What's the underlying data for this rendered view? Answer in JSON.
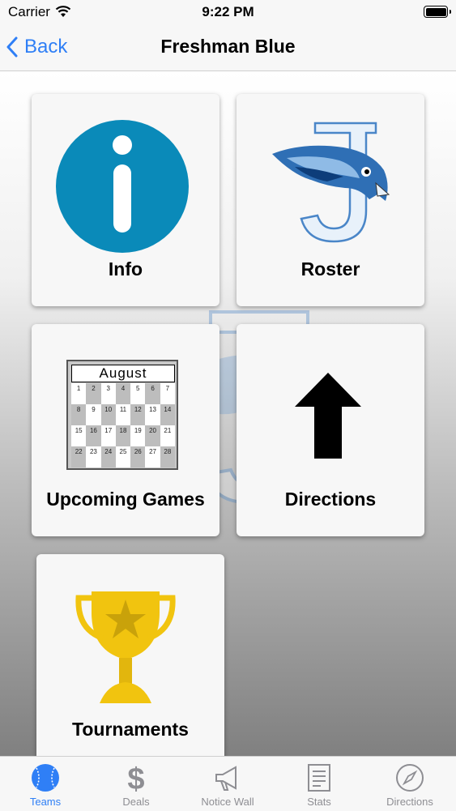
{
  "status_bar": {
    "carrier": "Carrier",
    "time": "9:22 PM"
  },
  "nav": {
    "back_label": "Back",
    "title": "Freshman Blue"
  },
  "tiles": {
    "info": {
      "label": "Info",
      "icon": "info-icon"
    },
    "roster": {
      "label": "Roster",
      "icon": "bluejay-logo"
    },
    "upcoming_games": {
      "label": "Upcoming Games",
      "icon": "calendar-icon",
      "month": "August",
      "days": [
        "1",
        "2",
        "3",
        "4",
        "5",
        "6",
        "7",
        "8",
        "9",
        "10",
        "11",
        "12",
        "13",
        "14",
        "15",
        "16",
        "17",
        "18",
        "19",
        "20",
        "21",
        "22",
        "23",
        "24",
        "25",
        "26",
        "27",
        "28"
      ]
    },
    "directions": {
      "label": "Directions",
      "icon": "up-arrow-icon"
    },
    "tournaments": {
      "label": "Tournaments",
      "icon": "trophy-icon"
    }
  },
  "tab_bar": {
    "items": [
      {
        "label": "Teams",
        "icon": "baseball-icon",
        "active": true
      },
      {
        "label": "Deals",
        "icon": "dollar-icon",
        "active": false
      },
      {
        "label": "Notice Wall",
        "icon": "megaphone-icon",
        "active": false
      },
      {
        "label": "Stats",
        "icon": "document-icon",
        "active": false
      },
      {
        "label": "Directions",
        "icon": "compass-icon",
        "active": false
      }
    ]
  },
  "colors": {
    "accent": "#2f7ff6",
    "info_circle": "#0a8ab9",
    "bluejay_blue": "#2f6fb5",
    "trophy_gold": "#f1c40f",
    "tab_inactive": "#8e8e93"
  }
}
